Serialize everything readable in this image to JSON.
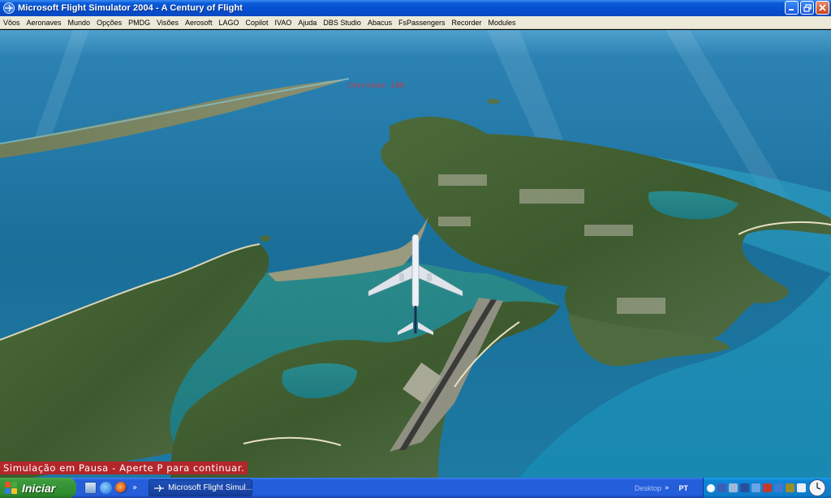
{
  "window": {
    "title": "Microsoft Flight Simulator 2004 - A Century of Flight",
    "buttons": [
      "minimize",
      "restore",
      "close"
    ]
  },
  "menu": {
    "items": [
      "Vôos",
      "Aeronaves",
      "Mundo",
      "Opções",
      "PMDG",
      "Visões",
      "Aerosoft",
      "LAGO",
      "Copilot",
      "IVAO",
      "Ajuda",
      "DBS Studio",
      "Abacus",
      "FsPassengers",
      "Recorder",
      "Modules"
    ]
  },
  "scene": {
    "ai_aircraft_label": "Cherokee 180",
    "pause_message": "Simulação em Pausa - Aperte P para continuar."
  },
  "taskbar": {
    "start_label": "Iniciar",
    "quicklaunch_icons": [
      "desktop-icon",
      "internet-explorer-icon",
      "firefox-icon"
    ],
    "task_button_label": "Microsoft Flight Simul...",
    "desktop_label": "Desktop",
    "language": "PT"
  },
  "colors": {
    "title_bar": "#0550d0",
    "menu_bar": "#ece9d8",
    "taskbar": "#245edb",
    "start_button": "#2e8b2e",
    "pause_banner": "#b3262a",
    "ai_label": "#c8374a"
  }
}
